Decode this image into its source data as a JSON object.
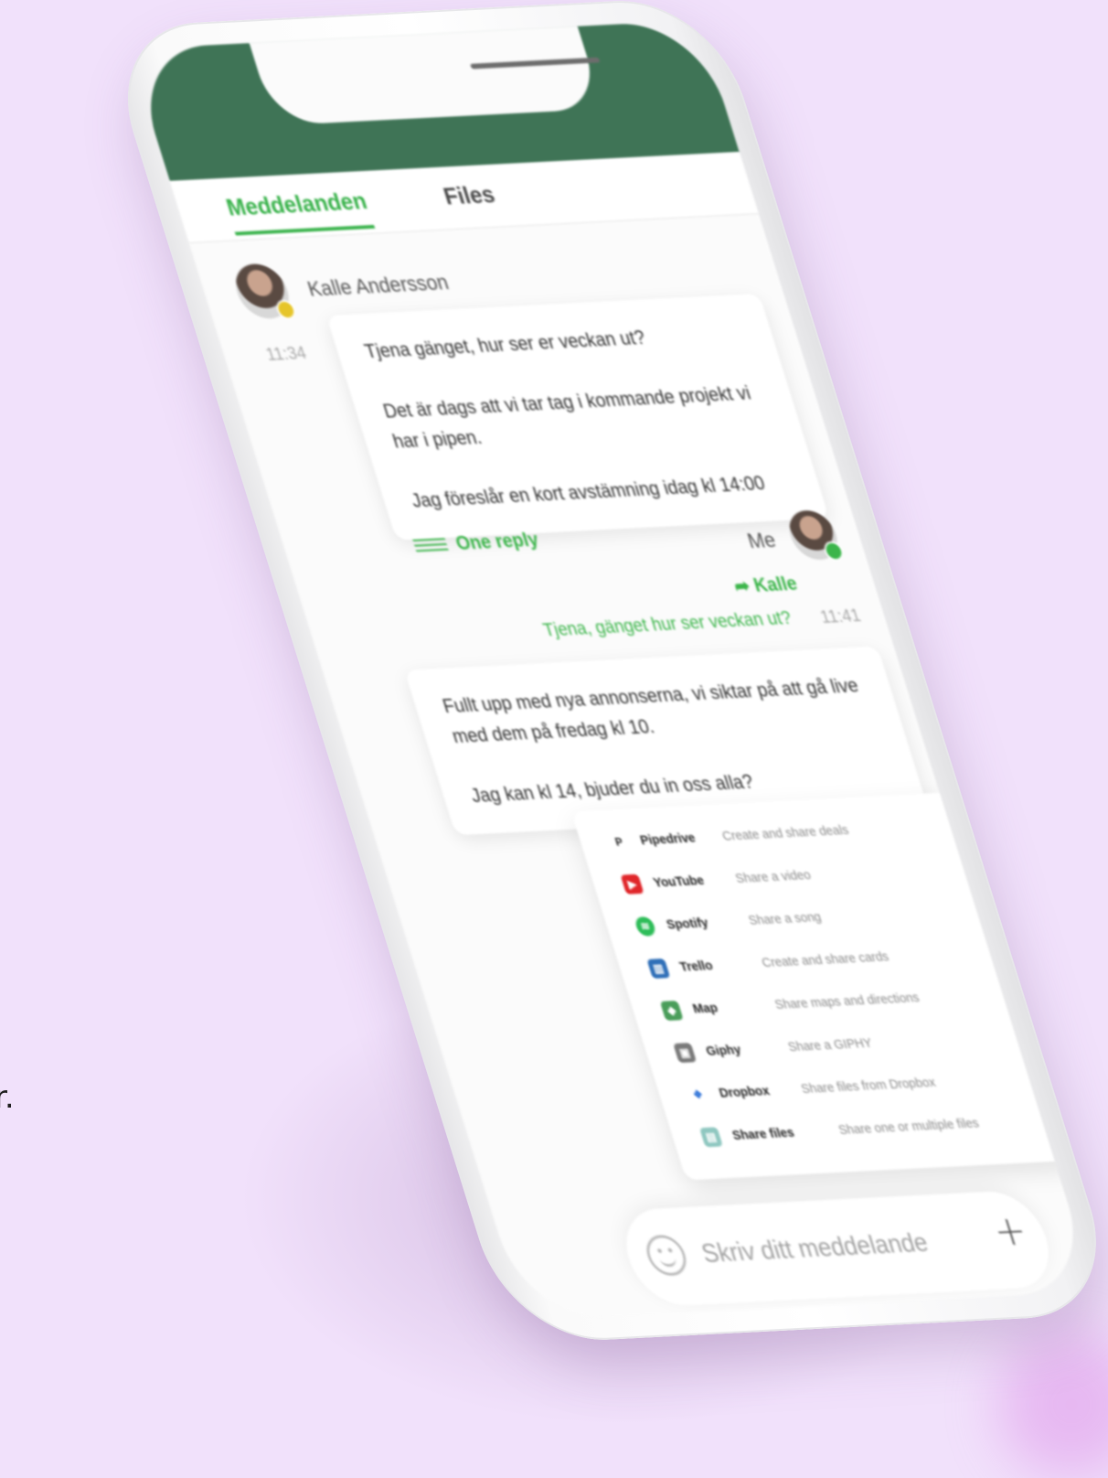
{
  "edge_text": "r.",
  "tabs": [
    {
      "label": "Meddelanden",
      "active": true
    },
    {
      "label": "Files",
      "active": false
    }
  ],
  "messages": {
    "incoming": {
      "sender": "Kalle Andersson",
      "time": "11:34",
      "paragraphs": [
        "Tjena gänget, hur ser er veckan ut?",
        "Det är dags att vi tar tag i kommande projekt vi har i pipen.",
        "Jag föreslår en kort avstämning idag kl 14:00"
      ],
      "reply_link": "One reply"
    },
    "outgoing": {
      "sender": "Me",
      "quote_author": "Kalle",
      "quote_text": "Tjena, gänget hur ser veckan ut?",
      "time": "11:41",
      "paragraphs": [
        "Fullt upp med nya annonserna, vi siktar på att gå live med dem på fredag kl 10.",
        "Jag kan kl 14, bjuder du in oss alla?"
      ]
    }
  },
  "integrations": [
    {
      "name": "Pipedrive",
      "desc": "Create and share deals",
      "glyph": "P",
      "color": "#222222",
      "icon": "pipedrive-icon"
    },
    {
      "name": "YouTube",
      "desc": "Share a video",
      "glyph": "▶",
      "color": "#e0262a",
      "icon": "youtube-icon"
    },
    {
      "name": "Spotify",
      "desc": "Share a song",
      "glyph": "≋",
      "color": "#2ebd59",
      "icon": "spotify-icon"
    },
    {
      "name": "Trello",
      "desc": "Create and share cards",
      "glyph": "▥",
      "color": "#2f6fb8",
      "icon": "trello-icon"
    },
    {
      "name": "Map",
      "desc": "Share maps and directions",
      "glyph": "◆",
      "color": "#4a9d5a",
      "icon": "map-icon"
    },
    {
      "name": "Giphy",
      "desc": "Share a GIPHY",
      "glyph": "▣",
      "color": "#7a7a7a",
      "icon": "giphy-icon"
    },
    {
      "name": "Dropbox",
      "desc": "Share files from Dropbox",
      "glyph": "❖",
      "color": "#2f73d8",
      "icon": "dropbox-icon"
    },
    {
      "name": "Share files",
      "desc": "Share one or multiple files",
      "glyph": "▤",
      "color": "#8fc7c0",
      "icon": "file-icon"
    }
  ],
  "composer": {
    "placeholder": "Skriv ditt meddelande",
    "plus": "+"
  },
  "colors": {
    "brand_green": "#3bb54a",
    "header_green": "#3f7456",
    "background": "#f1e1fb"
  }
}
